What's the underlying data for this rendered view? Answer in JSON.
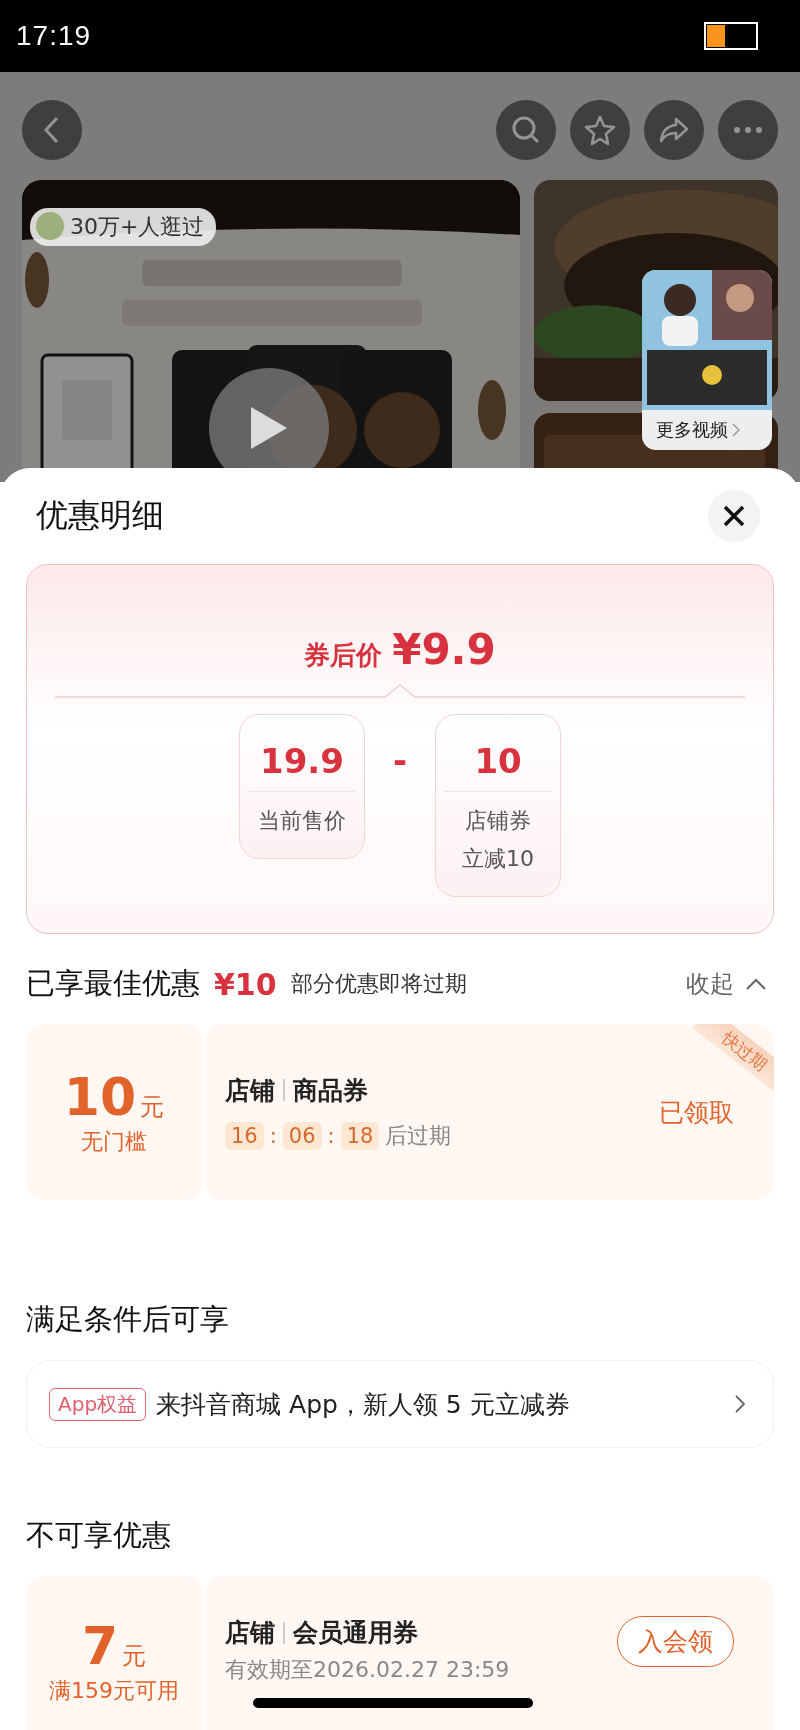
{
  "status_bar": {
    "time": "17:19"
  },
  "product": {
    "visitors_badge": "30万+人逛过",
    "more_videos": "更多视频"
  },
  "sheet": {
    "title": "优惠明细",
    "price_summary": {
      "label": "券后价",
      "currency": "¥",
      "amount": "9.9",
      "operator": "-",
      "terms": [
        {
          "value": "19.9",
          "label": "当前售价"
        },
        {
          "value": "10",
          "label": "店铺券",
          "note": "立减10"
        }
      ]
    },
    "best": {
      "title": "已享最佳优惠",
      "amount": "¥10",
      "note": "部分优惠即将过期",
      "toggle": "收起",
      "expanded": true,
      "coupons": [
        {
          "amount": "10",
          "unit": "元",
          "condition": "无门槛",
          "scope": "店铺",
          "type": "商品券",
          "ribbon": "快过期",
          "countdown": [
            "16",
            "06",
            "18"
          ],
          "countdown_separator": ":",
          "countdown_suffix": "后过期",
          "action": "已领取",
          "claimed": true
        }
      ]
    },
    "conditional": {
      "title": "满足条件后可享",
      "offers": [
        {
          "tag": "App权益",
          "text": "来抖音商城 App，新人领 5 元立减券"
        }
      ]
    },
    "unavailable": {
      "title": "不可享优惠",
      "coupons": [
        {
          "amount": "7",
          "unit": "元",
          "condition": "满159元可用",
          "scope": "店铺",
          "type": "会员通用券",
          "validity": "有效期至2026.02.27 23:59",
          "action": "入会领",
          "claimed": false
        }
      ]
    }
  }
}
